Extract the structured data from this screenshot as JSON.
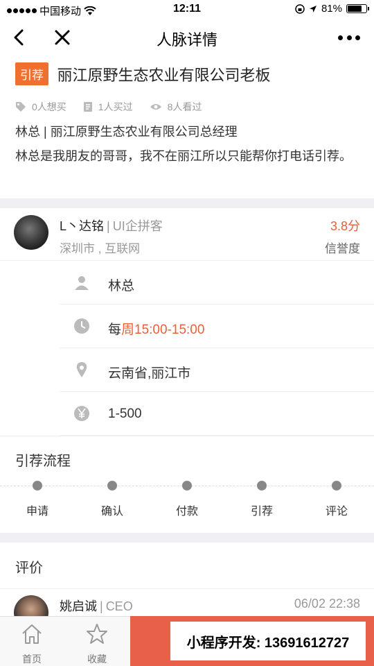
{
  "status_bar": {
    "carrier": "中国移动",
    "time": "12:11",
    "battery": "81%"
  },
  "nav": {
    "title": "人脉详情"
  },
  "header": {
    "tag": "引荐",
    "title": "丽江原野生态农业有限公司老板",
    "stats": {
      "want": "0人想买",
      "bought": "1人买过",
      "viewed": "8人看过"
    },
    "subtitle": "林总 | 丽江原野生态农业有限公司总经理",
    "description": "林总是我朋友的哥哥，我不在丽江所以只能帮你打电话引荐。"
  },
  "seller": {
    "name": "L丶达铭",
    "role": "UI企拼客",
    "location": "深圳市 , 互联网",
    "score": "3.8分",
    "score_label": "信誉度"
  },
  "details": {
    "contact": "林总",
    "time_prefix": "每",
    "time_value": "周15:00-15:00",
    "location": "云南省,丽江市",
    "price": "1-500"
  },
  "flow": {
    "title": "引荐流程",
    "steps": [
      "申请",
      "确认",
      "付款",
      "引荐",
      "评论"
    ]
  },
  "reviews": {
    "title": "评价",
    "items": [
      {
        "name": "姚启诚",
        "role": "CEO",
        "time": "06/02 22:38"
      }
    ]
  },
  "tabbar": {
    "home": "首页",
    "favorite": "收藏",
    "promo": "小程序开发: 13691612727"
  },
  "colors": {
    "accent": "#e8603a",
    "tag": "#f07030",
    "cta": "#e8604a"
  }
}
